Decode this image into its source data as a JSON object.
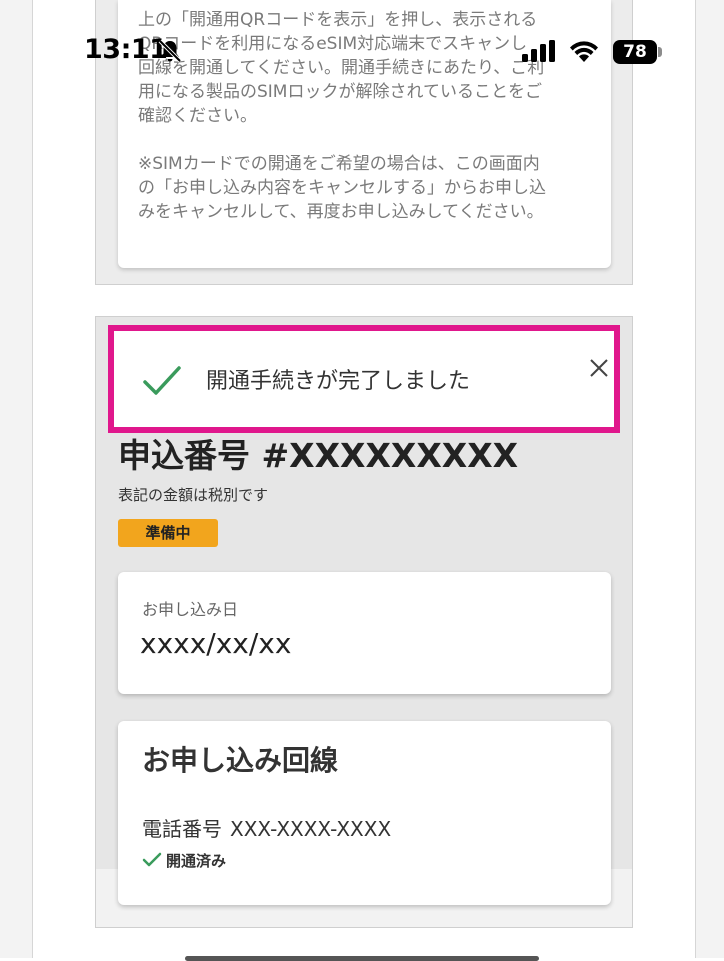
{
  "status_bar": {
    "time": "13:11",
    "battery": "78"
  },
  "notice": {
    "text": "上の「開通用QRコードを表示」を押し、表示される\nQRコードを利用になるeSIM対応端末でスキャンし\n回線を開通してください。開通手続きにあたり、ご利\n用になる製品のSIMロックが解除されていることをご\n確認ください。\n\n※SIMカードでの開通をご希望の場合は、この画面内\nの「お申し込み内容をキャンセルする」からお申し込\nみをキャンセルして、再度お申し込みしてください。"
  },
  "toast": {
    "message": "開通手続きが完了しました"
  },
  "order": {
    "title": "申込番号 #XXXXXXXXX",
    "tax_note": "表記の金額は税別です",
    "status": "準備中"
  },
  "application_date": {
    "label": "お申し込み日",
    "value": "xxxx/xx/xx"
  },
  "line": {
    "title": "お申し込み回線",
    "phone_label": "電話番号",
    "phone_number": "XXX-XXXX-XXXX",
    "opened_status": "開通済み"
  },
  "colors": {
    "highlight": "#e0178c",
    "check_green": "#3a9b5c",
    "badge": "#f2a51d"
  }
}
